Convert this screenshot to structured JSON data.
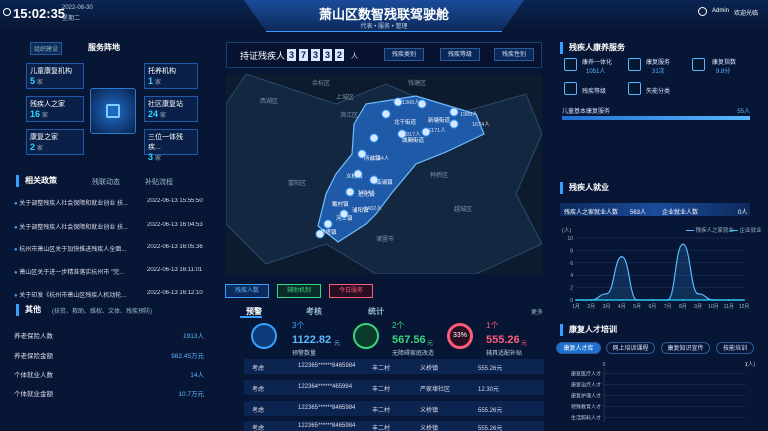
{
  "header": {
    "time": "15:02:35",
    "date": "2022-08-30",
    "weekday": "星期二",
    "title": "萧山区数智残联驾驶舱",
    "nav": [
      "代表",
      "服务",
      "管理"
    ],
    "user": "Admin",
    "welcome": "欢迎光临"
  },
  "left": {
    "service": {
      "tag": "组织建设",
      "title": "服务阵地",
      "items": [
        {
          "label": "儿童康复机构",
          "value": "5",
          "unit": "家"
        },
        {
          "label": "托养机构",
          "value": "1",
          "unit": "家"
        },
        {
          "label": "残疾人之家",
          "value": "16",
          "unit": "家"
        },
        {
          "label": "社区康复站",
          "value": "24",
          "unit": "家"
        },
        {
          "label": "康复之家",
          "value": "2",
          "unit": "家"
        },
        {
          "label": "三位一体残疾...",
          "value": "3",
          "unit": "家"
        }
      ]
    },
    "policy": {
      "title": "相关政策",
      "tabs": [
        "残联动态",
        "补贴流程"
      ],
      "items": [
        {
          "text": "关于调整残疾人社会保障和就业创业 扶...",
          "time": "2022-06-13 15:55:50"
        },
        {
          "text": "关于调整残疾人社会保障和就业创业 扶...",
          "time": "2022-06-13 16:04:53"
        },
        {
          "text": "杭州市萧山区关于加快推进残疾人全面...",
          "time": "2022-06-13 16:05:36"
        },
        {
          "text": "萧山区关于进一步精准落实杭州市 \"完...",
          "time": "2022-06-13 16:11:01"
        },
        {
          "text": "关于印发《杭州市萧山区残疾人机动轮...",
          "time": "2022-06-13 16:12:10"
        }
      ]
    },
    "other": {
      "title": "其他",
      "desc": "(扶贫、救助、维权、文体、残疾预防)",
      "items": [
        {
          "label": "养老保险人数",
          "value": "1913人"
        },
        {
          "label": "养老保险金额",
          "value": "982.45万元"
        },
        {
          "label": "个体就业人数",
          "value": "14人"
        },
        {
          "label": "个体就业金额",
          "value": "10.7万元"
        }
      ]
    }
  },
  "center": {
    "holders": {
      "label": "持证残疾人",
      "digits": [
        "3",
        "7",
        "3",
        "3",
        "2"
      ],
      "unit": "人",
      "buttons": [
        "残疾类别",
        "残疾等级",
        "残疾性别"
      ]
    },
    "map": {
      "places": [
        {
          "name": "钱塘区"
        },
        {
          "name": "余杭区"
        },
        {
          "name": "西湖区"
        },
        {
          "name": "上城区"
        },
        {
          "name": "滨江区"
        },
        {
          "name": "富阳区"
        },
        {
          "name": "柯桥区"
        },
        {
          "name": "越城区"
        },
        {
          "name": "诸暨市"
        },
        {
          "name": "新塘街道"
        },
        {
          "name": "北干街道"
        },
        {
          "name": "城厢街道"
        },
        {
          "name": "所前镇"
        },
        {
          "name": "义桥镇"
        },
        {
          "name": "河上镇"
        },
        {
          "name": "楼塔镇"
        },
        {
          "name": "进化镇"
        },
        {
          "name": "戴村镇"
        },
        {
          "name": "浦阳镇"
        },
        {
          "name": "临浦镇"
        }
      ],
      "counts": [
        "1366人",
        "917人",
        "1184人",
        "1864人",
        "1402人",
        "1674人",
        "1989人",
        "6171人"
      ],
      "buttons": [
        "残疾人数",
        "辅助机制",
        "今日服务"
      ]
    },
    "tabs": [
      "预警",
      "考核",
      "统计"
    ],
    "more": "更多",
    "stats": [
      {
        "count": "3个",
        "value": "1122.82",
        "unit": "元",
        "label": "预警数量"
      },
      {
        "count": "2个",
        "value": "567.56",
        "unit": "元",
        "label": "无障碍家庭改造"
      },
      {
        "count": "1个",
        "value": "555.26",
        "unit": "元",
        "label": "辅具适配补贴",
        "pct": "33%"
      }
    ],
    "table": [
      {
        "c1": "考虑",
        "c2": "122365******8465984",
        "c3": "丰二村",
        "c4": "义桥镇",
        "c5": "555.26元"
      },
      {
        "c1": "考虑",
        "c2": "122364******465984",
        "c3": "丰二村",
        "c4": "严家埭社区",
        "c5": "12.30元"
      },
      {
        "c1": "考虑",
        "c2": "122365******8465984",
        "c3": "丰二村",
        "c4": "义桥镇",
        "c5": "555.26元"
      },
      {
        "c1": "考虑",
        "c2": "122365******8465984",
        "c3": "丰二村",
        "c4": "义桥镇",
        "c5": "555.26元"
      }
    ]
  },
  "right": {
    "rehab": {
      "title": "残疾人康养服务",
      "items": [
        {
          "label": "康养一体化",
          "value": "1051人"
        },
        {
          "label": "康复服务",
          "value": "31次"
        },
        {
          "label": "康复指数",
          "value": "9.8分"
        },
        {
          "label": "残疾等级",
          "value": ""
        },
        {
          "label": "失能分类",
          "value": ""
        }
      ],
      "child": {
        "label": "儿童基本康复服务",
        "value": "55人"
      }
    },
    "employ": {
      "title": "残疾人就业",
      "a_label": "残疾人之家就业人数",
      "a_value": "563人",
      "b_label": "企业就业人数",
      "b_value": "0人",
      "unit": "(人)",
      "legend": [
        "残疾人之家就业",
        "企业就业"
      ]
    },
    "talent": {
      "title": "康复人才培训",
      "chips": [
        "康复人才库",
        "网上培训课程",
        "康复知识宣传",
        "技能培训"
      ],
      "unit": "(人)",
      "rows": [
        "康复医疗人才",
        "康复治疗人才",
        "康复护理人才",
        "特殊教育人才",
        "生活照料人才"
      ]
    }
  },
  "chart_data": [
    {
      "type": "line",
      "title": "",
      "xlabel": "",
      "ylabel": "(人)",
      "x": [
        "1月",
        "2月",
        "3月",
        "4月",
        "5月",
        "6月",
        "7月",
        "8月",
        "9月",
        "10月",
        "11月",
        "12月"
      ],
      "ylim": [
        0,
        10
      ],
      "series": [
        {
          "name": "残疾人之家就业",
          "values": [
            0,
            0,
            1,
            7,
            0,
            0,
            0,
            9,
            1,
            0,
            0,
            0
          ]
        },
        {
          "name": "企业就业",
          "values": [
            0,
            0,
            0,
            0,
            0,
            0,
            0,
            0,
            0,
            0,
            0,
            0
          ]
        }
      ]
    },
    {
      "type": "bar",
      "title": "",
      "xlabel": "",
      "ylabel": "(人)",
      "categories": [
        "康复医疗人才",
        "康复治疗人才",
        "康复护理人才",
        "特殊教育人才",
        "生活照料人才"
      ],
      "values": [
        0,
        0,
        0,
        0,
        0
      ],
      "xlim": [
        0,
        1
      ]
    }
  ],
  "colors": {
    "accent": "#3aa0ff",
    "cyan": "#28d7ff",
    "green": "#38d67a",
    "red": "#ff5a7a",
    "bg": "#071634"
  }
}
